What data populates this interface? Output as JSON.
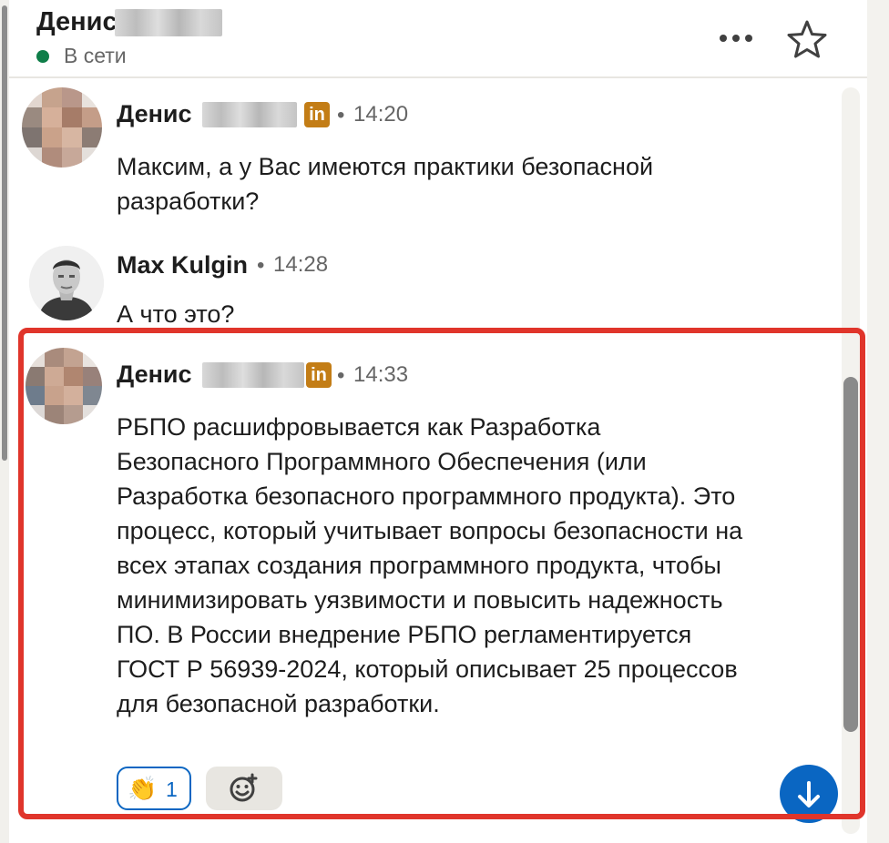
{
  "header": {
    "contact_name": "Денис",
    "status": "В сети",
    "more_icon": "more-horizontal-icon",
    "star_icon": "star-outline-icon"
  },
  "messages": [
    {
      "sender": "Денис",
      "separator": "•",
      "time": "14:20",
      "badge": "in",
      "text": "Максим, а у Вас имеются практики безопасной разработки?"
    },
    {
      "sender": "Max Kulgin",
      "separator": "•",
      "time": "14:28",
      "text": "А что это?"
    },
    {
      "sender": "Денис",
      "separator": "•",
      "time": "14:33",
      "badge": "in",
      "text": "РБПО расшифровывается как Разработка Безопасного Программного Обеспечения (или Разработка безопасного программного продукта). Это процесс, который учитывает вопросы безопасности на всех этапах создания программного продукта, чтобы минимизировать уязвимости и повысить надежность ПО. В России внедрение РБПО регламентируется ГОСТ Р 56939-2024, который описывает 25 процессов для безопасной разработки.",
      "reactions": [
        {
          "emoji": "👏",
          "count": "1"
        }
      ]
    }
  ],
  "colors": {
    "online": "#0f7e49",
    "accent": "#0a66c2",
    "linkedin_badge": "#c37d16",
    "highlight": "#e0352b"
  }
}
